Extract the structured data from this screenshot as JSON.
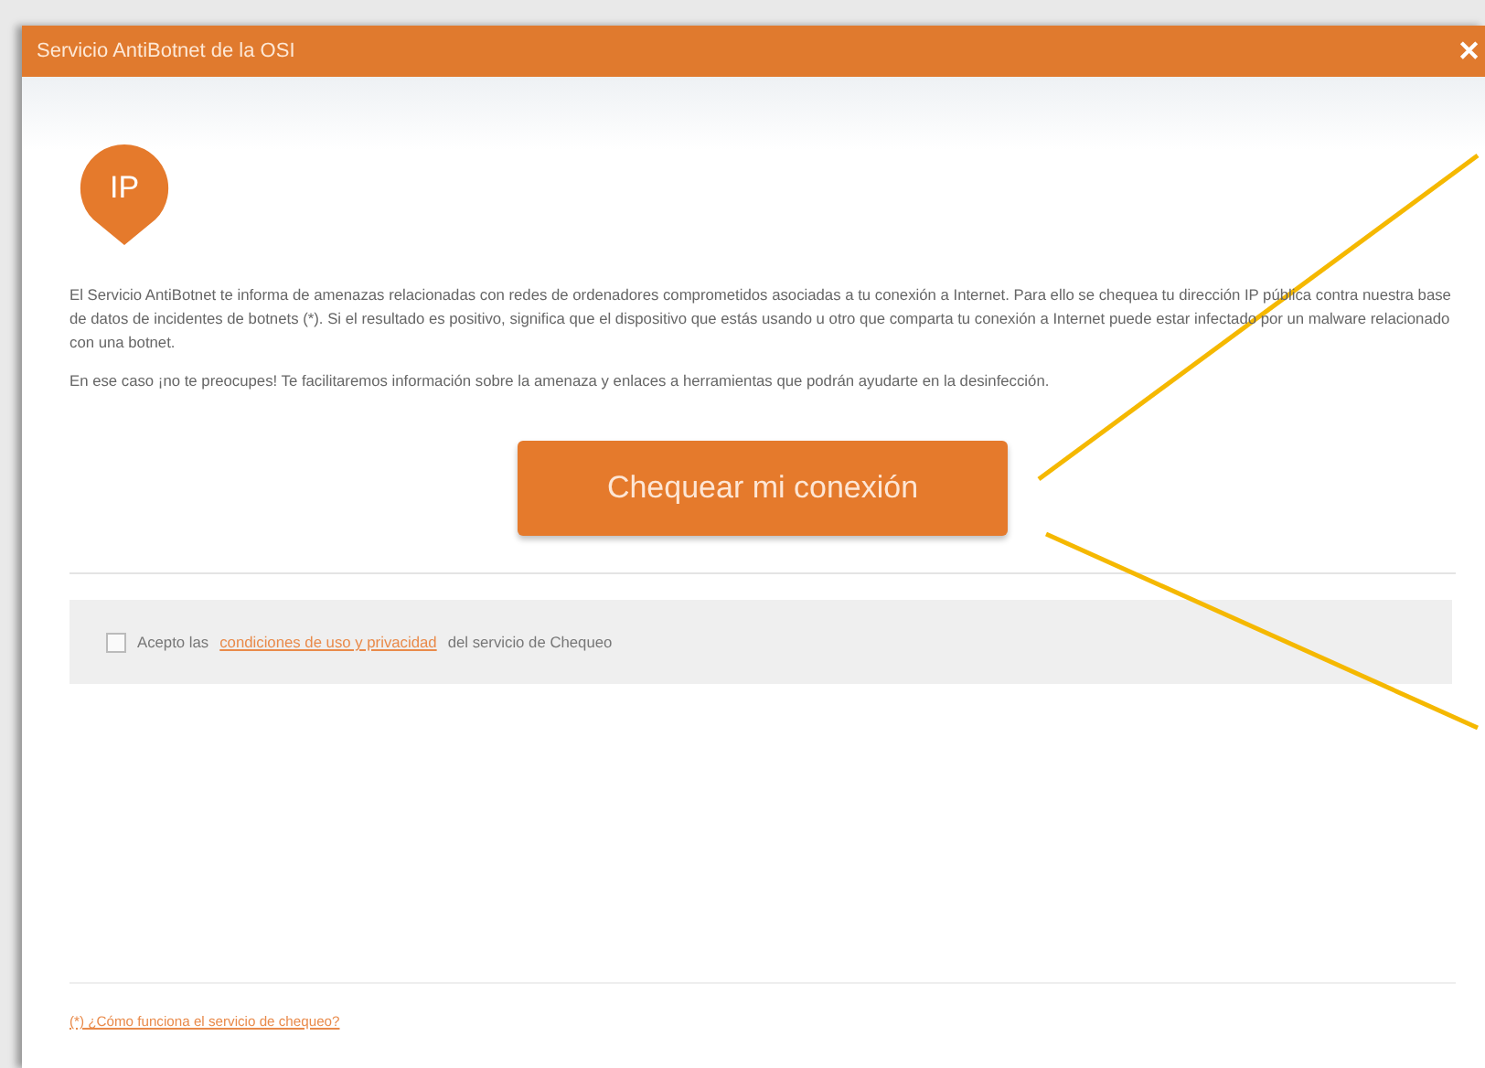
{
  "window": {
    "title": "Servicio AntiBotnet de la OSI",
    "close": "✕"
  },
  "badge": "IP",
  "paragraphs": [
    "El Servicio AntiBotnet te informa de amenazas relacionadas con redes de ordenadores comprometidos asociadas a tu conexión a Internet. Para ello se chequea tu dirección IP pública contra nuestra base de datos de incidentes de botnets (*). Si el resultado es positivo, significa que el dispositivo que estás usando u otro que comparta tu conexión a Internet puede estar infectado por un malware relacionado con una botnet.",
    "En ese caso ¡no te preocupes! Te facilitaremos información sobre la amenaza y enlaces a herramientas que podrán ayudarte en la desinfección."
  ],
  "check_button": "Chequear mi conexión",
  "consent": {
    "checked": false,
    "before": "Acepto las",
    "link": "condiciones de uso y privacidad",
    "after": "del servicio de Chequeo"
  },
  "footnote_link": "(*) ¿Cómo funciona el servicio de chequeo?"
}
